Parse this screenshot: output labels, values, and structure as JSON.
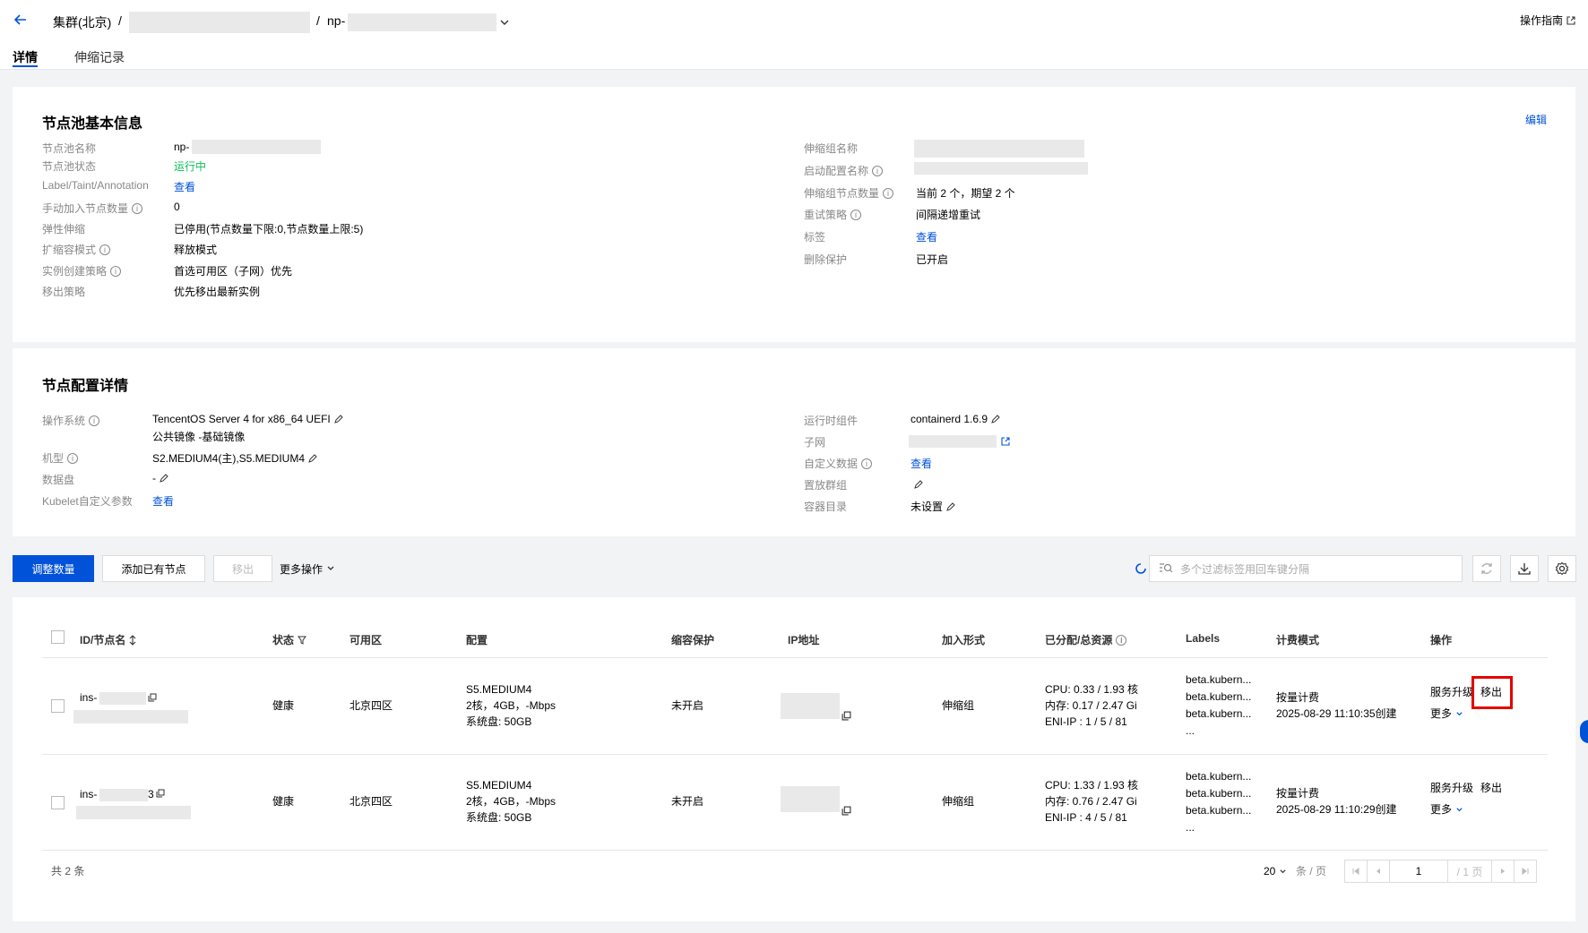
{
  "header": {
    "breadcrumb_region": "集群(北京)",
    "separator": "/",
    "nodepool_prefix": "np-",
    "guide_label": "操作指南"
  },
  "tabs": [
    {
      "label": "详情",
      "active": true
    },
    {
      "label": "伸缩记录",
      "active": false
    }
  ],
  "basic_info": {
    "title": "节点池基本信息",
    "edit_label": "编辑",
    "left": [
      {
        "label": "节点池名称",
        "value": "np-",
        "info": false
      },
      {
        "label": "节点池状态",
        "value": "运行中",
        "info": false,
        "status": "green"
      },
      {
        "label": "Label/Taint/Annotation",
        "value": "查看",
        "info": false,
        "link": true
      },
      {
        "label": "手动加入节点数量",
        "value": "0",
        "info": true
      },
      {
        "label": "弹性伸缩",
        "value": "已停用(节点数量下限:0,节点数量上限:5)",
        "info": false
      },
      {
        "label": "扩缩容模式",
        "value": "释放模式",
        "info": true
      },
      {
        "label": "实例创建策略",
        "value": "首选可用区（子网）优先",
        "info": true
      },
      {
        "label": "移出策略",
        "value": "优先移出最新实例",
        "info": false
      }
    ],
    "right": [
      {
        "label": "伸缩组名称",
        "value": "",
        "info": false
      },
      {
        "label": "启动配置名称",
        "value": "",
        "info": true
      },
      {
        "label": "伸缩组节点数量",
        "value": "当前 2 个，期望 2 个",
        "info": true
      },
      {
        "label": "重试策略",
        "value": "间隔递增重试",
        "info": true
      },
      {
        "label": "标签",
        "value": "查看",
        "info": false,
        "link": true
      },
      {
        "label": "删除保护",
        "value": "已开启",
        "info": false
      }
    ]
  },
  "node_config": {
    "title": "节点配置详情",
    "left": [
      {
        "label": "操作系统",
        "value": "TencentOS Server 4 for x86_64 UEFI",
        "value2": "公共镜像 -基础镜像",
        "info": true
      },
      {
        "label": "机型",
        "value": "S2.MEDIUM4(主),S5.MEDIUM4",
        "info": true
      },
      {
        "label": "数据盘",
        "value": "-",
        "info": false
      },
      {
        "label": "Kubelet自定义参数",
        "value": "查看",
        "info": false,
        "link": true
      }
    ],
    "right": [
      {
        "label": "运行时组件",
        "value": "containerd 1.6.9",
        "info": false
      },
      {
        "label": "子网",
        "value": "",
        "info": false
      },
      {
        "label": "自定义数据",
        "value": "查看",
        "info": true,
        "link": true
      },
      {
        "label": "置放群组",
        "value": "",
        "info": false
      },
      {
        "label": "容器目录",
        "value": "未设置",
        "info": false
      }
    ]
  },
  "toolbar": {
    "adjust_label": "调整数量",
    "add_existing_label": "添加已有节点",
    "remove_label": "移出",
    "more_label": "更多操作",
    "search_placeholder": "多个过滤标签用回车键分隔"
  },
  "table": {
    "columns": [
      "ID/节点名",
      "状态",
      "可用区",
      "配置",
      "缩容保护",
      "IP地址",
      "加入形式",
      "已分配/总资源",
      "Labels",
      "计费模式",
      "操作"
    ],
    "rows": [
      {
        "id": "ins-",
        "status": "健康",
        "zone": "北京四区",
        "config": [
          "S5.MEDIUM4",
          "2核，4GB，-Mbps",
          "系统盘: 50GB"
        ],
        "scale_protect": "未开启",
        "join": "伸缩组",
        "resources": [
          "CPU: 0.33 / 1.93 核",
          "内存: 0.17 / 2.47 Gi",
          "ENI-IP : 1 / 5 / 81"
        ],
        "labels": [
          "beta.kubern...",
          "beta.kubern...",
          "beta.kubern...",
          "..."
        ],
        "billing": [
          "按量计费",
          "2025-08-29 11:10:35创建"
        ],
        "op_upgrade": "服务升级",
        "op_remove": "移出",
        "op_more": "更多"
      },
      {
        "id": "ins-",
        "id_suffix": "3",
        "status": "健康",
        "zone": "北京四区",
        "config": [
          "S5.MEDIUM4",
          "2核，4GB，-Mbps",
          "系统盘: 50GB"
        ],
        "scale_protect": "未开启",
        "join": "伸缩组",
        "resources": [
          "CPU: 1.33 / 1.93 核",
          "内存: 0.76 / 2.47 Gi",
          "ENI-IP : 4 / 5 / 81"
        ],
        "labels": [
          "beta.kubern...",
          "beta.kubern...",
          "beta.kubern...",
          "..."
        ],
        "billing": [
          "按量计费",
          "2025-08-29 11:10:29创建"
        ],
        "op_upgrade": "服务升级",
        "op_remove": "移出",
        "op_more": "更多"
      }
    ],
    "total": "共 2 条",
    "page_size": "20",
    "per_page_label": "条 / 页",
    "page_number": "1",
    "page_total": "/ 1 页"
  },
  "colors": {
    "primary": "#0052d9",
    "healthy": "#0abf5b",
    "highlight": "#e60000"
  }
}
